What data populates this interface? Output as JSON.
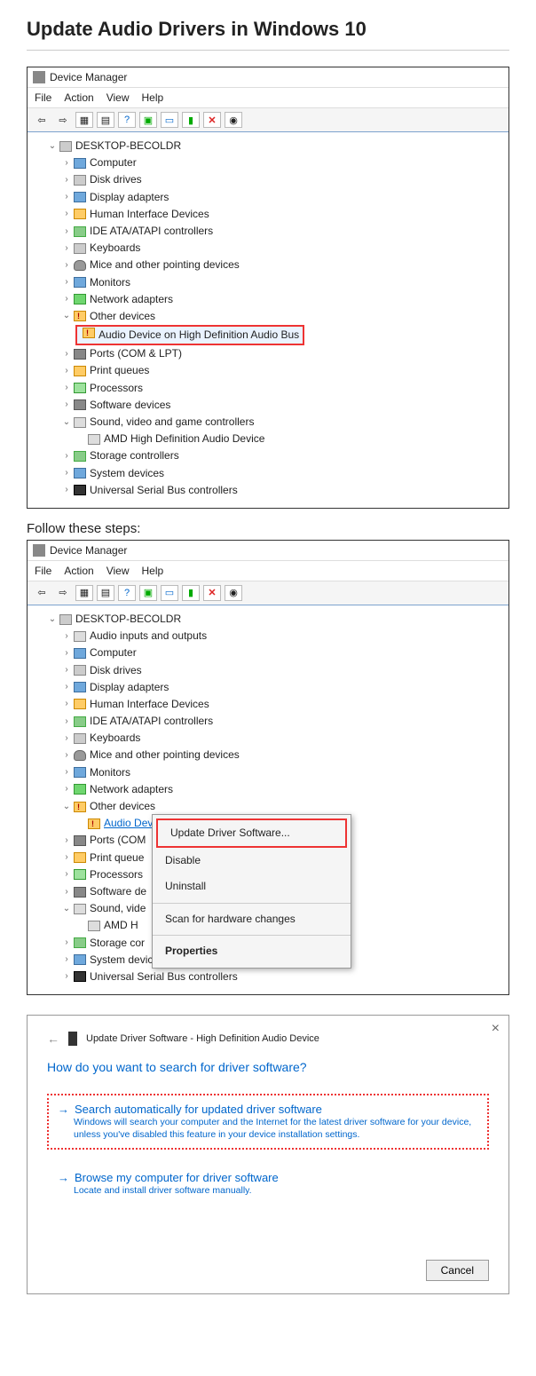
{
  "page": {
    "heading": "Update Audio Drivers in Windows 10",
    "follow": "Follow these steps:"
  },
  "dm": {
    "title": "Device Manager",
    "menu": {
      "file": "File",
      "action": "Action",
      "view": "View",
      "help": "Help"
    },
    "root": "DESKTOP-BECOLDR",
    "cat": {
      "computer": "Computer",
      "disk": "Disk drives",
      "display": "Display adapters",
      "hid": "Human Interface Devices",
      "ide": "IDE ATA/ATAPI controllers",
      "keyboards": "Keyboards",
      "mice": "Mice and other pointing devices",
      "monitors": "Monitors",
      "network": "Network adapters",
      "other": "Other devices",
      "audio_bus": "Audio Device on High Definition Audio Bus",
      "ports": "Ports (COM & LPT)",
      "printq": "Print queues",
      "proc": "Processors",
      "softdev": "Software devices",
      "sound": "Sound, video and game controllers",
      "amd": "AMD High Definition Audio Device",
      "storage": "Storage controllers",
      "sysdev": "System devices",
      "usb": "Universal Serial Bus controllers",
      "audio_io": "Audio inputs and outputs",
      "ports_cut": "Ports (COM",
      "printq_cut": "Print queue",
      "proc_cut": "Processors",
      "softdev_cut": "Software de",
      "sound_cut": "Sound, vide",
      "amd_cut": "AMD H",
      "storage_cut": "Storage cor"
    }
  },
  "ctx": {
    "update": "Update Driver Software...",
    "disable": "Disable",
    "uninstall": "Uninstall",
    "scan": "Scan for hardware changes",
    "props": "Properties"
  },
  "wiz": {
    "title": "Update Driver Software - High Definition Audio Device",
    "q": "How do you want to search for driver software?",
    "opt1": {
      "h": "Search automatically for updated driver software",
      "d": "Windows will search your computer and the Internet for the latest driver software for your device, unless you've disabled this feature in your device installation settings."
    },
    "opt2": {
      "h": "Browse my computer for driver software",
      "d": "Locate and install driver software manually."
    },
    "cancel": "Cancel"
  }
}
